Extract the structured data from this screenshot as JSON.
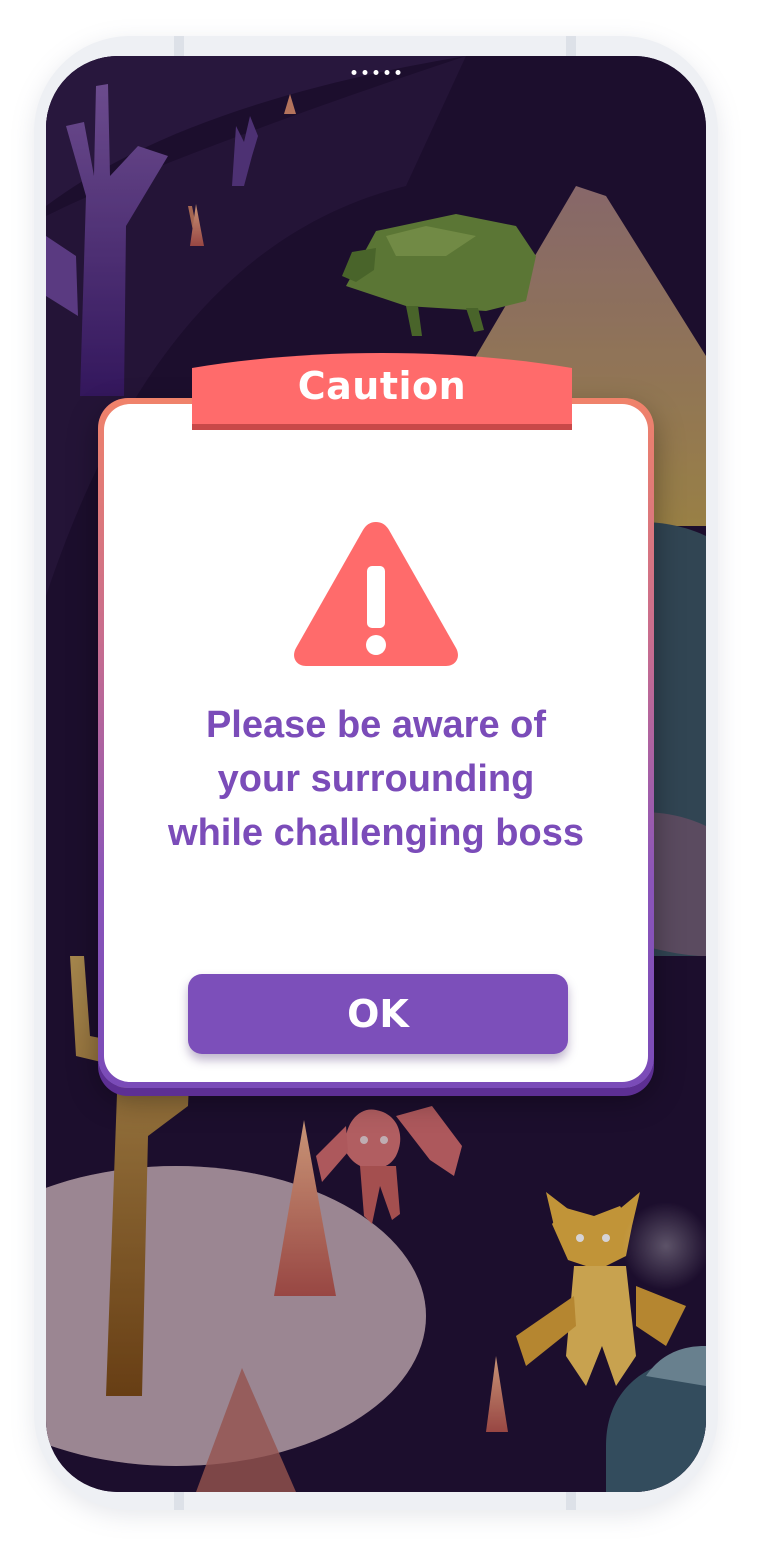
{
  "dialog": {
    "title": "Caution",
    "icon": "warning-triangle-icon",
    "message": "Please be aware of\nyour surrounding\nwhile challenging boss",
    "ok_label": "OK"
  },
  "colors": {
    "caution_red": "#ff6b6b",
    "accent_purple": "#7c4fba",
    "background_night": "#1e0f30"
  }
}
